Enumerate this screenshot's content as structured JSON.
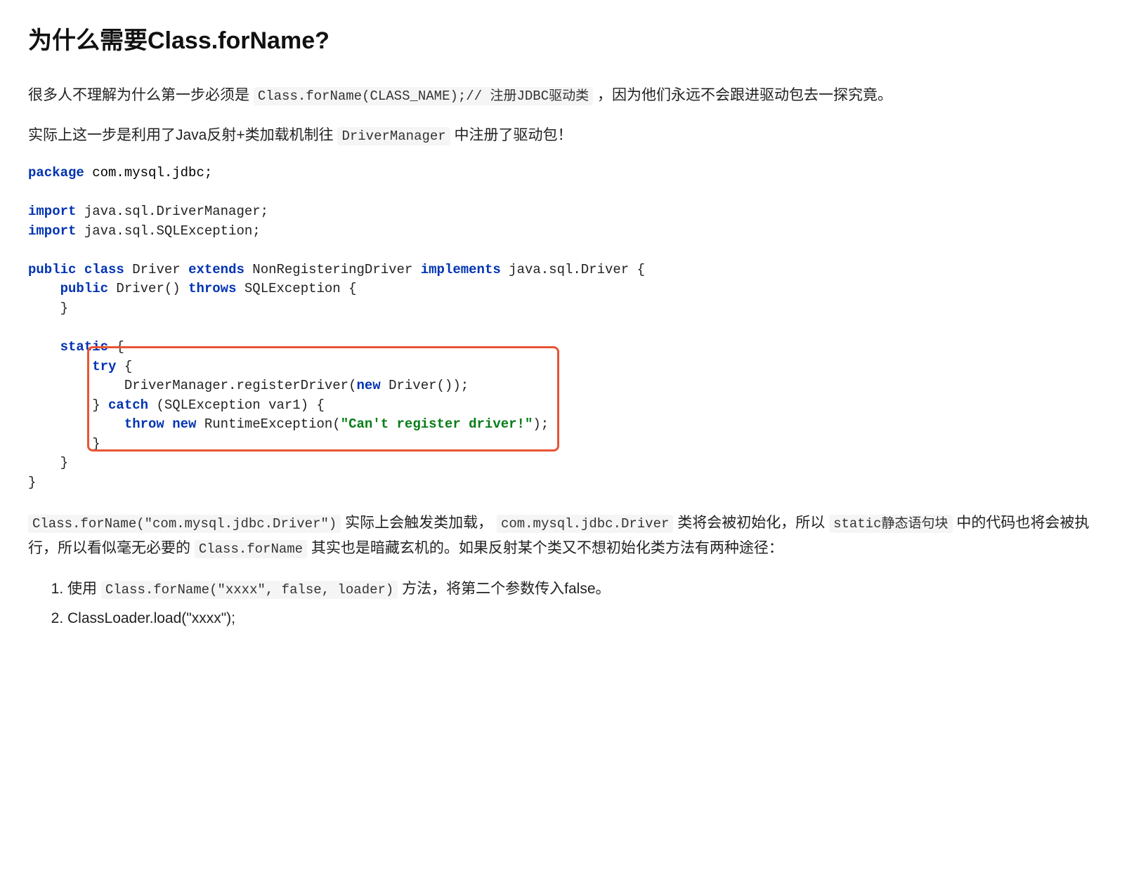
{
  "heading": "为什么需要Class.forName?",
  "para1_a": "很多人不理解为什么第一步必须是 ",
  "para1_code": "Class.forName(CLASS_NAME);// 注册JDBC驱动类",
  "para1_b": " ，因为他们永远不会跟进驱动包去一探究竟。",
  "para2_a": "实际上这一步是利用了Java反射+类加载机制往 ",
  "para2_code": "DriverManager",
  "para2_b": " 中注册了驱动包！",
  "code": {
    "l01_kw1": "package",
    "l01_t": " com.mysql.jdbc;",
    "l03_kw1": "import",
    "l03_t": " java.sql.DriverManager;",
    "l04_kw1": "import",
    "l04_t": " java.sql.SQLException;",
    "l06_kw1": "public",
    "l06_kw2": "class",
    "l06_t1": " Driver ",
    "l06_kw3": "extends",
    "l06_t2": " NonRegisteringDriver ",
    "l06_kw4": "implements",
    "l06_t3": " java.sql.Driver {",
    "l07_kw1": "public",
    "l07_t1": " Driver() ",
    "l07_kw2": "throws",
    "l07_t2": " SQLException {",
    "l08_t": "    }",
    "l10_kw1": "static",
    "l10_t": " {",
    "l11_kw1": "try",
    "l11_t": " {",
    "l12_t1": "            DriverManager.registerDriver(",
    "l12_kw1": "new",
    "l12_t2": " Driver());",
    "l13_t1": "        } ",
    "l13_kw1": "catch",
    "l13_t2": " (SQLException var1) {",
    "l14_kw1": "throw",
    "l14_kw2": "new",
    "l14_t1": " RuntimeException(",
    "l14_str": "\"Can't register driver!\"",
    "l14_t2": ");",
    "l15_t": "        }",
    "l16_t": "    }",
    "l17_t": "}"
  },
  "para3_code1": "Class.forName(\"com.mysql.jdbc.Driver\")",
  "para3_a": " 实际上会触发类加载， ",
  "para3_code2": "com.mysql.jdbc.Driver",
  "para3_b": " 类将会被初始化，所以 ",
  "para3_code3": "static静态语句块",
  "para3_c": " 中的代码也将会被执行，所以看似毫无必要的 ",
  "para3_code4": "Class.forName",
  "para3_d": " 其实也是暗藏玄机的。如果反射某个类又不想初始化类方法有两种途径：",
  "li1_a": "使用 ",
  "li1_code": "Class.forName(\"xxxx\", false, loader)",
  "li1_b": " 方法，将第二个参数传入false。",
  "li2": "ClassLoader.load(\"xxxx\");"
}
